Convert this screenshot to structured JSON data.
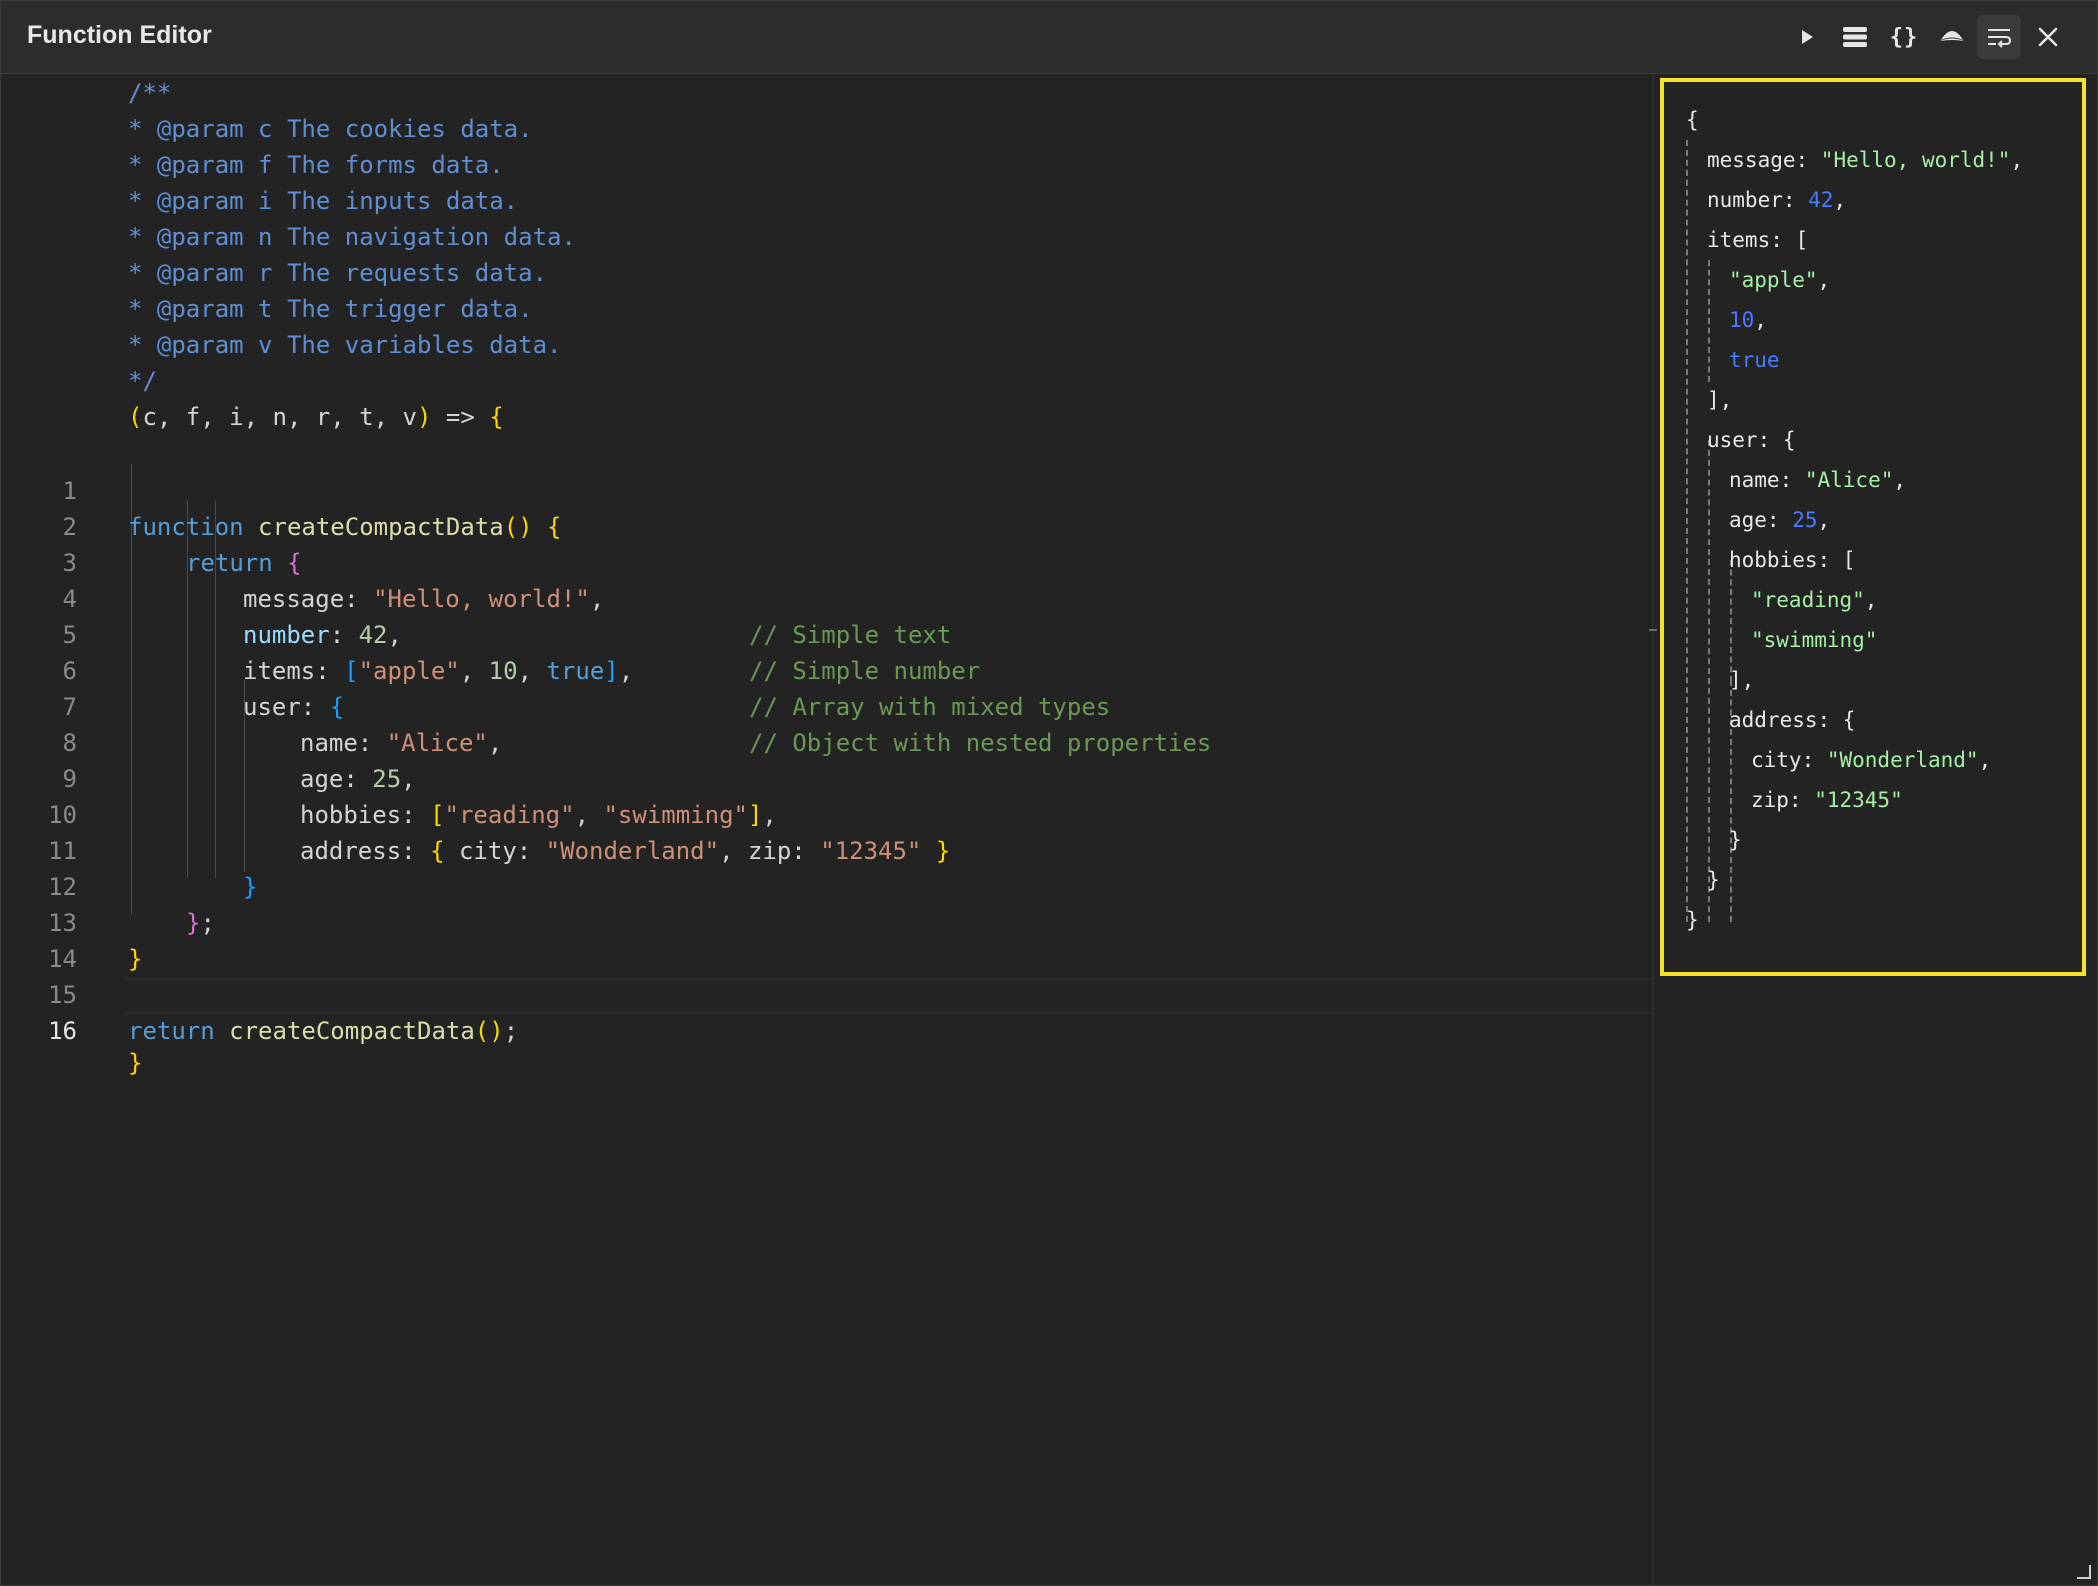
{
  "window": {
    "title": "Function Editor"
  },
  "toolbar": {
    "run": "play-icon",
    "format": "list-icon",
    "braces": "{}",
    "hat": "hat-icon",
    "wrap": "wrap-icon",
    "close": "close-icon"
  },
  "editor": {
    "header_lines": [
      "/**",
      "* @param c The cookies data.",
      "* @param f The forms data.",
      "* @param i The inputs data.",
      "* @param n The navigation data.",
      "* @param r The requests data.",
      "* @param t The trigger data.",
      "* @param v The variables data.",
      "*/"
    ],
    "signature": [
      "(",
      "c, f, i, n, r, t, v",
      ")",
      " => ",
      "{"
    ],
    "line_numbers": [
      "1",
      "2",
      "3",
      "4",
      "5",
      "6",
      "7",
      "8",
      "9",
      "10",
      "11",
      "12",
      "13",
      "14",
      "15",
      "16"
    ],
    "code": {
      "l1": [
        "function",
        " createCompactData",
        "(",
        ")",
        " ",
        "{"
      ],
      "l2": [
        "return",
        " ",
        "{"
      ],
      "l3": [
        "message",
        ": ",
        "\"Hello, world!\"",
        ",",
        "// Simple text"
      ],
      "l4": [
        "number",
        ": ",
        "42",
        ",",
        "// Simple number"
      ],
      "l5": [
        "items",
        ": ",
        "[",
        "\"apple\"",
        ", ",
        "10",
        ", ",
        "true",
        "]",
        ",",
        "// Array with mixed types"
      ],
      "l6": [
        "user",
        ": ",
        "{",
        "// Object with nested properties"
      ],
      "l7": [
        "name",
        ": ",
        "\"Alice\"",
        ","
      ],
      "l8": [
        "age",
        ": ",
        "25",
        ","
      ],
      "l9": [
        "hobbies",
        ": ",
        "[",
        "\"reading\"",
        ", ",
        "\"swimming\"",
        "]",
        ","
      ],
      "l10": [
        "address",
        ": ",
        "{",
        " city: ",
        "\"Wonderland\"",
        ", zip: ",
        "\"12345\"",
        " ",
        "}"
      ],
      "l11": [
        "}"
      ],
      "l12": [
        "}",
        ";"
      ],
      "l13": [
        "}"
      ],
      "l15": [
        "return",
        " createCompactData",
        "(",
        ")",
        ";"
      ]
    },
    "footer": "}"
  },
  "output": {
    "lines": [
      {
        "text": [
          "{"
        ]
      },
      {
        "text": [
          "message: ",
          "\"Hello, world!\"",
          ","
        ]
      },
      {
        "text": [
          "number: ",
          "42",
          ","
        ]
      },
      {
        "text": [
          "items: ["
        ]
      },
      {
        "text": [
          "\"apple\"",
          ","
        ]
      },
      {
        "text": [
          "10",
          ","
        ]
      },
      {
        "text": [
          "true"
        ]
      },
      {
        "text": [
          "],"
        ]
      },
      {
        "text": [
          "user: {"
        ]
      },
      {
        "text": [
          "name: ",
          "\"Alice\"",
          ","
        ]
      },
      {
        "text": [
          "age: ",
          "25",
          ","
        ]
      },
      {
        "text": [
          "hobbies: ["
        ]
      },
      {
        "text": [
          "\"reading\"",
          ","
        ]
      },
      {
        "text": [
          "\"swimming\""
        ]
      },
      {
        "text": [
          "],"
        ]
      },
      {
        "text": [
          "address: {"
        ]
      },
      {
        "text": [
          "city: ",
          "\"Wonderland\"",
          ","
        ]
      },
      {
        "text": [
          "zip: ",
          "\"12345\""
        ]
      },
      {
        "text": [
          "}"
        ]
      },
      {
        "text": [
          "}"
        ]
      },
      {
        "text": [
          "}"
        ]
      }
    ]
  },
  "colors": {
    "highlight_border": "#f5e22a",
    "comment": "#6a9955",
    "string": "#ce9178",
    "keyword": "#569cd6"
  }
}
